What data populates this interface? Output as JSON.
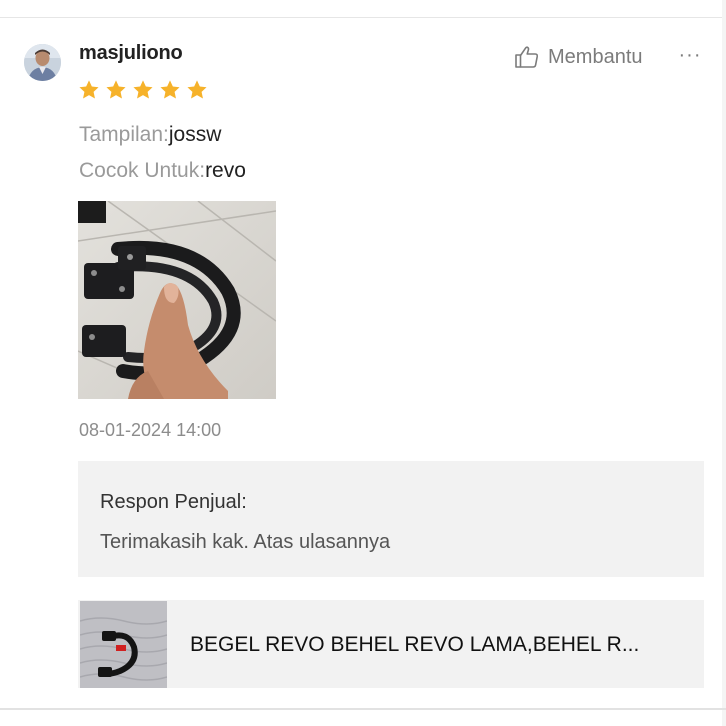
{
  "review": {
    "username": "masjuliono",
    "rating": 5,
    "helpful_label": "Membantu",
    "more_label": "···",
    "attributes": [
      {
        "label": "Tampilan:",
        "value": "jossw"
      },
      {
        "label": "Cocok Untuk:",
        "value": "revo"
      }
    ],
    "timestamp": "08-01-2024 14:00"
  },
  "seller_response": {
    "title": "Respon Penjual:",
    "text": "Terimakasih kak. Atas ulasannya"
  },
  "product": {
    "name": "BEGEL REVO BEHEL REVO LAMA,BEHEL R..."
  },
  "icons": {
    "avatar": "user-avatar-photo",
    "helpful": "thumbs-up-icon",
    "more": "more-horizontal-icon",
    "star": "star-icon"
  },
  "colors": {
    "star": "#f6b22a",
    "text_primary": "#222222",
    "text_secondary": "#9a9a9a",
    "panel_bg": "#f2f2f2"
  }
}
